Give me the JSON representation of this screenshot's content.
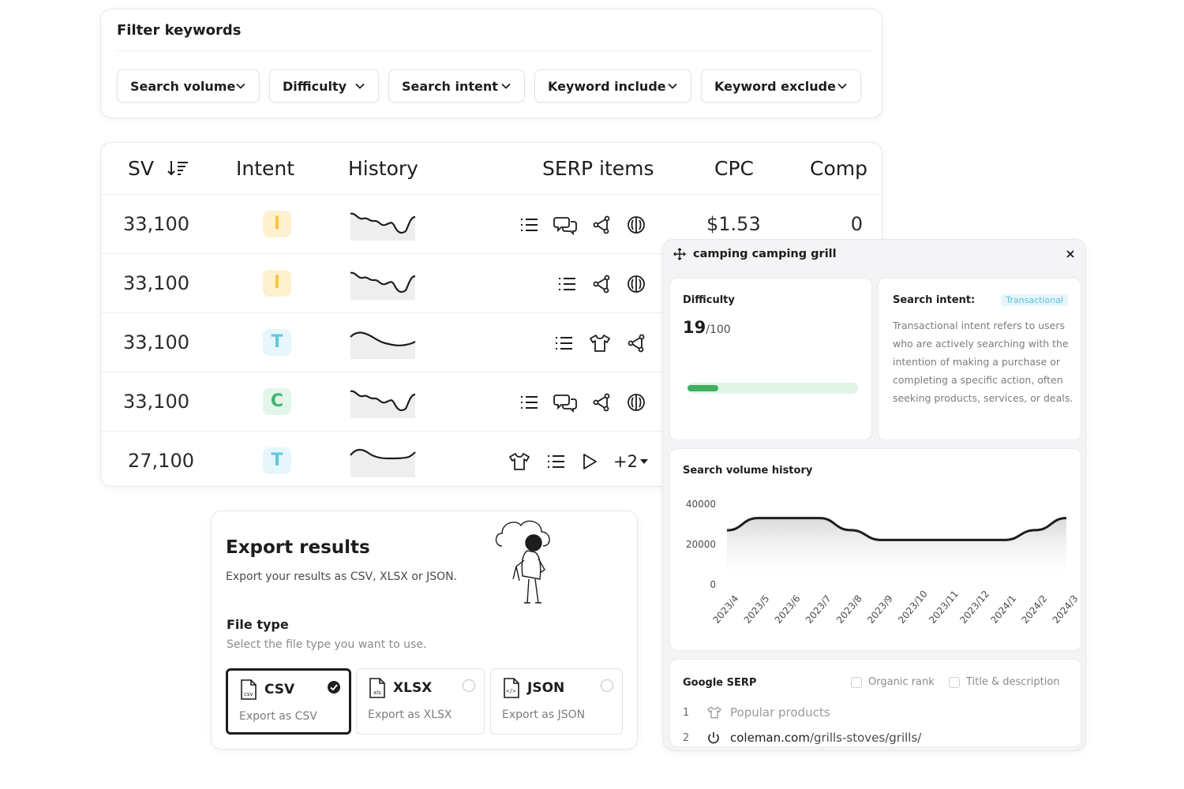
{
  "filter": {
    "title": "Filter keywords",
    "dropdowns": [
      {
        "label": "Search volume"
      },
      {
        "label": "Difficulty"
      },
      {
        "label": "Search intent"
      },
      {
        "label": "Keyword include"
      },
      {
        "label": "Keyword exclude"
      }
    ]
  },
  "table": {
    "headers": {
      "sv": "SV",
      "intent": "Intent",
      "history": "History",
      "serp": "SERP items",
      "cpc": "CPC",
      "comp": "Comp"
    },
    "rows": [
      {
        "sv": "33,100",
        "intent": "I",
        "serp_icons": [
          "list-icon",
          "chat-icon",
          "share-icon",
          "brain-icon"
        ],
        "cpc": "$1.53",
        "comp": "0"
      },
      {
        "sv": "33,100",
        "intent": "I",
        "serp_icons": [
          "list-icon",
          "share-icon",
          "brain-icon"
        ]
      },
      {
        "sv": "33,100",
        "intent": "T",
        "serp_icons": [
          "list-icon",
          "shirt-icon",
          "share-icon"
        ]
      },
      {
        "sv": "33,100",
        "intent": "C",
        "serp_icons": [
          "list-icon",
          "chat-icon",
          "share-icon",
          "brain-icon"
        ]
      },
      {
        "sv": "27,100",
        "intent": "T",
        "serp_icons": [
          "shirt-icon",
          "list-icon",
          "play-icon"
        ],
        "serp_more": "+2"
      }
    ]
  },
  "intent_colors": {
    "I": {
      "bg": "#fdf1cf",
      "fg": "#f5c542"
    },
    "T": {
      "bg": "#e6f6fb",
      "fg": "#62c9dd"
    },
    "C": {
      "bg": "#e3f6ea",
      "fg": "#3fb873"
    }
  },
  "export": {
    "title": "Export results",
    "subtitle": "Export your results as CSV, XLSX or JSON.",
    "file_type_label": "File type",
    "file_type_hint": "Select the file type you want to use.",
    "options": [
      {
        "name": "CSV",
        "desc": "Export as CSV",
        "icon_text": "csv",
        "selected": true
      },
      {
        "name": "XLSX",
        "desc": "Export as XLSX",
        "icon_text": "xls",
        "selected": false
      },
      {
        "name": "JSON",
        "desc": "Export as JSON",
        "icon_text": "</>",
        "selected": false
      }
    ]
  },
  "detail": {
    "keyword": "camping camping grill",
    "difficulty": {
      "label": "Difficulty",
      "score": "19",
      "max": "/100",
      "value": 19
    },
    "intent": {
      "label": "Search intent:",
      "tag": "Transactional",
      "description": "Transactional intent refers to users who are actively searching with the intention of making a purchase or completing a specific action, often seeking products, services, or deals."
    },
    "history": {
      "label": "Search volume history"
    },
    "serp": {
      "label": "Google SERP",
      "options": [
        "Organic rank",
        "Title & description"
      ],
      "results": [
        {
          "rank": "1",
          "text": "Popular products"
        },
        {
          "rank": "2",
          "domain": "coleman.com",
          "path": "/grills-stoves/grills/"
        }
      ]
    }
  },
  "chart_data": {
    "type": "area",
    "title": "Search volume history",
    "categories": [
      "2023/4",
      "2023/5",
      "2023/6",
      "2023/7",
      "2023/8",
      "2023/9",
      "2023/10",
      "2023/11",
      "2023/12",
      "2024/1",
      "2024/2",
      "2024/3"
    ],
    "values": [
      27000,
      33100,
      33100,
      33100,
      27100,
      22200,
      22200,
      22200,
      22200,
      22200,
      27100,
      33100
    ],
    "yticks": [
      "40000",
      "20000",
      "0"
    ],
    "ylim": [
      0,
      40000
    ],
    "colors": {
      "line": "#1d1d1f",
      "fill_top": "#d9d9dc"
    }
  }
}
